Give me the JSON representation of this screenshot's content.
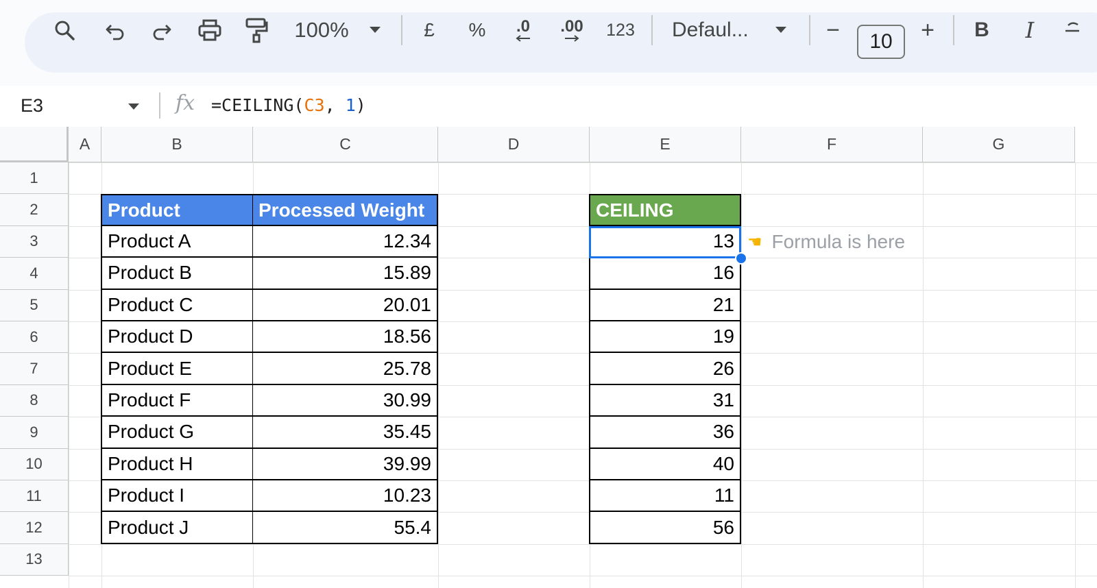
{
  "toolbar": {
    "zoom": "100%",
    "currency": "£",
    "percent": "%",
    "dec_decrease": ".0",
    "dec_increase": ".00",
    "number_format": "123",
    "font": "Defaul...",
    "font_size": "10",
    "minus": "−",
    "plus": "+",
    "bold": "B",
    "italic": "I"
  },
  "formula_bar": {
    "name_box": "E3",
    "fx": "fx",
    "formula_prefix": "=CEILING(",
    "formula_ref": "C3",
    "formula_sep": ", ",
    "formula_num": "1",
    "formula_suffix": ")"
  },
  "columns": [
    "A",
    "B",
    "C",
    "D",
    "E",
    "F",
    "G"
  ],
  "rows": [
    "1",
    "2",
    "3",
    "4",
    "5",
    "6",
    "7",
    "8",
    "9",
    "10",
    "11",
    "12",
    "13"
  ],
  "table": {
    "header_product": "Product",
    "header_weight": "Processed Weight",
    "header_ceiling": "CEILING",
    "products": [
      "Product A",
      "Product B",
      "Product C",
      "Product D",
      "Product E",
      "Product F",
      "Product G",
      "Product H",
      "Product I",
      "Product J"
    ],
    "weights": [
      "12.34",
      "15.89",
      "20.01",
      "18.56",
      "25.78",
      "30.99",
      "35.45",
      "39.99",
      "10.23",
      "55.4"
    ],
    "ceilings": [
      "13",
      "16",
      "21",
      "19",
      "26",
      "31",
      "36",
      "40",
      "11",
      "56"
    ]
  },
  "note": {
    "icon": "pointing-hand-icon",
    "text": "Formula is here"
  },
  "colors": {
    "header_blue": "#4a86e8",
    "header_green": "#6aa84f",
    "selection": "#1a73e8"
  }
}
